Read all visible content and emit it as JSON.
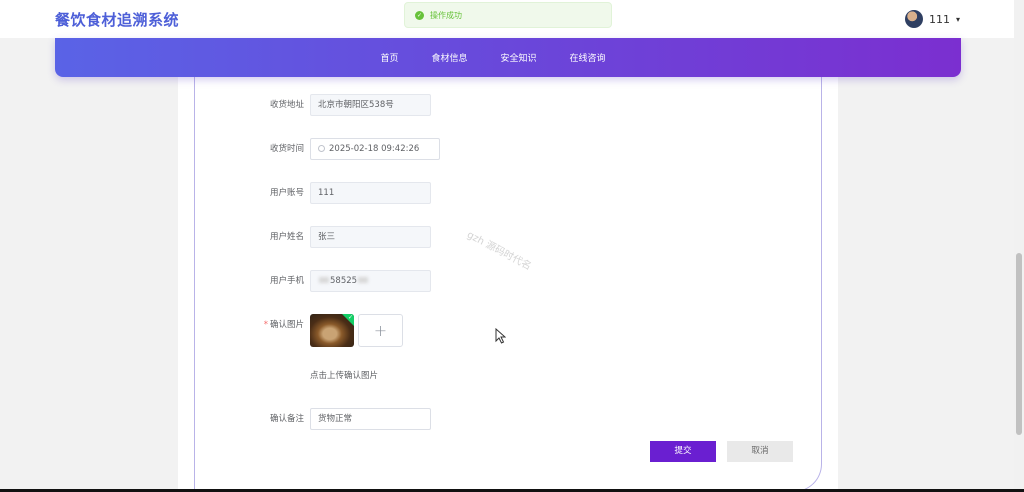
{
  "header": {
    "brand": "餐饮食材追溯系统",
    "user_name": "111",
    "caret": "▾"
  },
  "toast": {
    "message": "操作成功",
    "icon": "check-circle-icon",
    "color": "#67c23a"
  },
  "nav": {
    "items": [
      "首页",
      "食材信息",
      "安全知识",
      "在线咨询"
    ],
    "gradient": [
      "#5a63e6",
      "#7b2fd0"
    ]
  },
  "form": {
    "address": {
      "label": "收货地址",
      "value": "北京市朝阳区538号"
    },
    "time": {
      "label": "收货时间",
      "value": "2025-02-18 09:42:26"
    },
    "account": {
      "label": "用户账号",
      "value": "111"
    },
    "name": {
      "label": "用户姓名",
      "value": "张三"
    },
    "phone": {
      "label": "用户手机",
      "value": "58525"
    },
    "image": {
      "label": "确认图片",
      "required_mark": "*",
      "upload_tip": "点击上传确认图片",
      "plus": "+"
    },
    "remark": {
      "label": "确认备注",
      "value": "货物正常"
    }
  },
  "buttons": {
    "submit": "提交",
    "cancel": "取消",
    "submit_color": "#6a1fd1"
  },
  "watermark": "gzh 源码时代名"
}
